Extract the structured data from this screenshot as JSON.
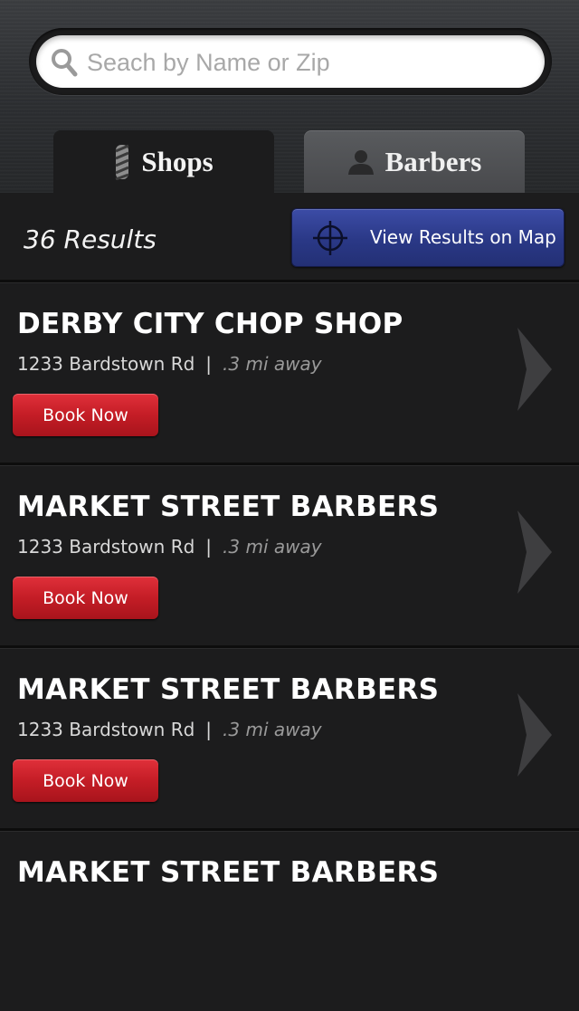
{
  "search": {
    "placeholder": "Seach by Name or Zip",
    "icon": "search-icon"
  },
  "tabs": [
    {
      "label": "Shops",
      "icon": "barber-pole-icon",
      "active": true
    },
    {
      "label": "Barbers",
      "icon": "person-icon",
      "active": false
    }
  ],
  "results": {
    "count_label": "36 Results",
    "map_button_label": "View Results on Map",
    "map_icon": "crosshair-icon"
  },
  "shops": [
    {
      "name": "DERBY CITY CHOP SHOP",
      "address": "1233 Bardstown Rd",
      "separator": "|",
      "distance": ".3 mi away",
      "book_label": "Book Now"
    },
    {
      "name": "MARKET STREET BARBERS",
      "address": "1233 Bardstown Rd",
      "separator": "|",
      "distance": ".3 mi away",
      "book_label": "Book Now"
    },
    {
      "name": "MARKET STREET BARBERS",
      "address": "1233 Bardstown Rd",
      "separator": "|",
      "distance": ".3 mi away",
      "book_label": "Book Now"
    },
    {
      "name": "MARKET STREET BARBERS",
      "address": "",
      "separator": "",
      "distance": "",
      "book_label": ""
    }
  ],
  "colors": {
    "background": "#1c1c1d",
    "map_button": "#2a3886",
    "book_button": "#c41d26"
  }
}
